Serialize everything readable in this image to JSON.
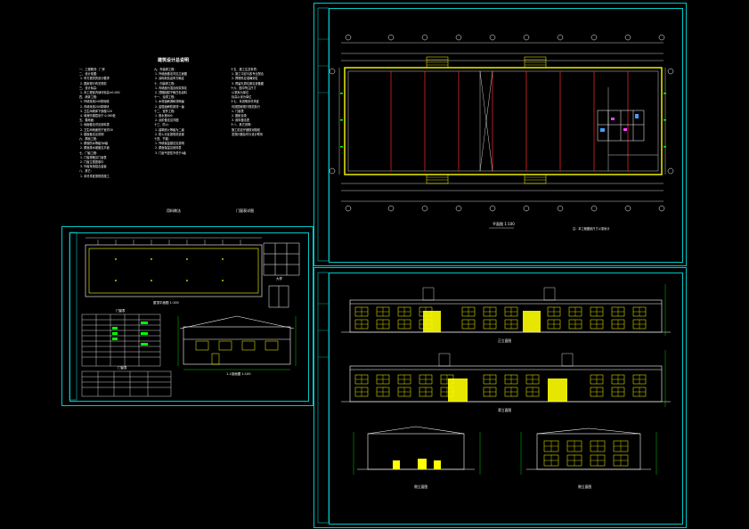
{
  "colors": {
    "background": "#000000",
    "frame": "#00c8c8",
    "wall": "#ffff00",
    "grid": "#ff2a2a",
    "text": "#ffffff",
    "dim": "#00ff00",
    "stair": "#ffff00"
  },
  "sheet_tl": {
    "title": "建筑设计总说明",
    "footer_left": "用料做法",
    "footer_right": "门窗表详图"
  },
  "sheet_bl": {
    "plan_label": "屋顶平面图 1:100",
    "section_label": "1-1剖面图 1:100",
    "detail_label": "大样",
    "table_title": "门窗表",
    "table2_title": "门窗表"
  },
  "sheet_tr": {
    "plan_label": "平面图",
    "plan_scale": "1:100",
    "plan_note": "注：本工程图纸尺寸以毫米计"
  },
  "sheet_br": {
    "elev1_label": "正立面图",
    "elev2_label": "背立面图",
    "elev3_label": "侧立面图",
    "elev4_label": "侧立面图"
  }
}
